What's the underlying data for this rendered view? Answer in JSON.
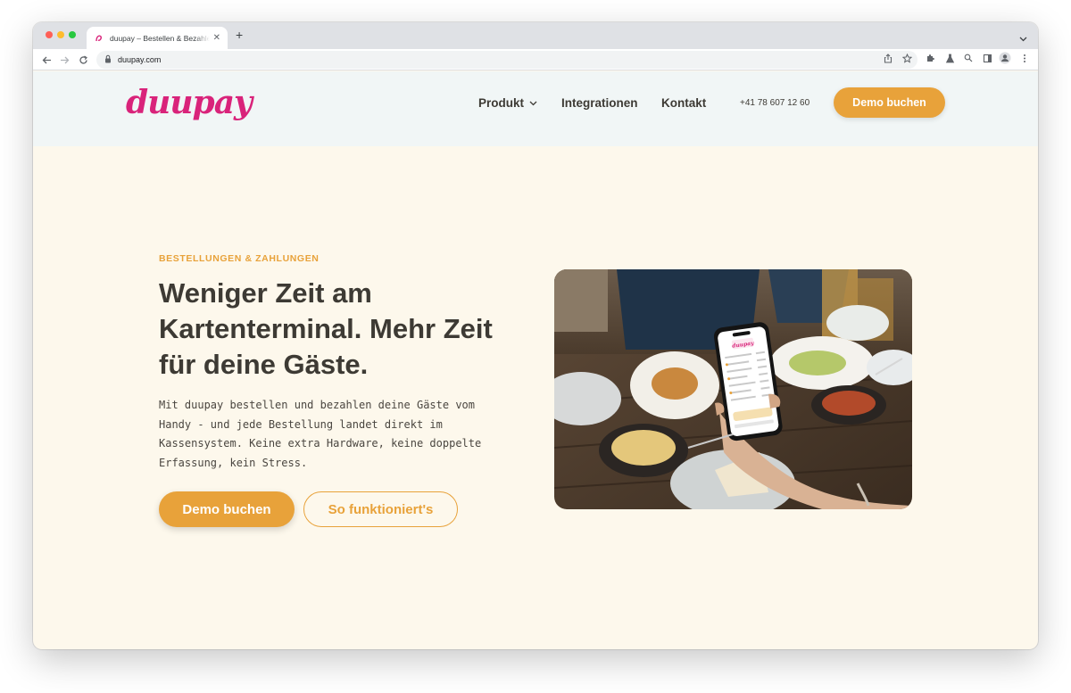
{
  "browser": {
    "tab_title": "duupay – Bestellen & Bezahlen",
    "url": "duupay.com"
  },
  "site": {
    "logo_text": "duupay",
    "nav": {
      "produkt": "Produkt",
      "integrationen": "Integrationen",
      "kontakt": "Kontakt",
      "phone": "+41 78 607 12 60",
      "demo_button": "Demo buchen"
    }
  },
  "hero": {
    "eyebrow": "BESTELLUNGEN & ZAHLUNGEN",
    "headline": "Weniger Zeit am Kartenterminal. Mehr Zeit für deine Gäste.",
    "lead": "Mit duupay bestellen und bezahlen deine Gäste vom Handy - und jede Bestellung landet direkt im Kassensystem. Keine extra Hardware, keine doppelte Erfassung, kein Stress.",
    "primary_button": "Demo buchen",
    "secondary_button": "So funktioniert's",
    "phone_logo": "duupay"
  },
  "colors": {
    "brand_pink": "#d9237a",
    "accent_orange": "#e8a23a",
    "page_bg": "#fdf8ec",
    "header_bg": "#f1f6f6",
    "text_dark": "#3d3a34"
  },
  "icons": {
    "favicon": "duupay-favicon-icon",
    "back": "arrow-left-icon",
    "forward": "arrow-right-icon",
    "reload": "reload-icon",
    "lock": "lock-icon",
    "share": "share-icon",
    "bookmark": "star-icon",
    "extensions": "puzzle-icon",
    "labs": "flask-icon",
    "search": "search-icon",
    "sidepanel": "sidepanel-icon",
    "profile": "profile-icon",
    "menu": "kebab-menu-icon",
    "nav_dropdown": "chevron-down-icon"
  }
}
